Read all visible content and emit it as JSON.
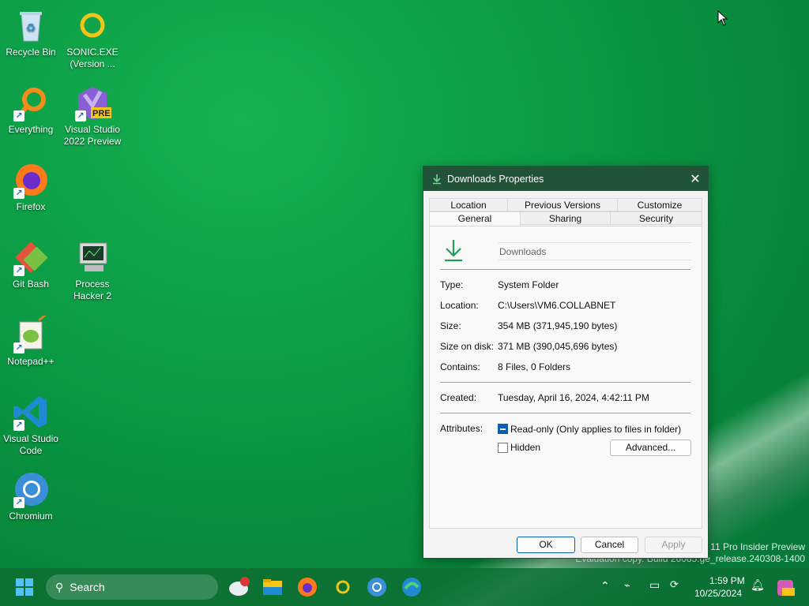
{
  "desktop_icons": [
    {
      "label": "Recycle Bin",
      "icon": "recycle-bin-icon"
    },
    {
      "label": "SONIC.EXE (Version ...",
      "icon": "sonic-icon"
    },
    {
      "label": "Everything",
      "icon": "everything-search-icon"
    },
    {
      "label": "Visual Studio 2022 Preview",
      "icon": "visual-studio-preview-icon",
      "badge": "PRE"
    },
    {
      "label": "Firefox",
      "icon": "firefox-icon"
    },
    {
      "label": "Git Bash",
      "icon": "git-bash-icon"
    },
    {
      "label": "Process Hacker 2",
      "icon": "process-hacker-icon"
    },
    {
      "label": "Notepad++",
      "icon": "notepad-plus-plus-icon"
    },
    {
      "label": "Visual Studio Code",
      "icon": "vscode-icon"
    },
    {
      "label": "Chromium",
      "icon": "chromium-icon"
    }
  ],
  "dialog": {
    "title": "Downloads Properties",
    "tabs_row1": [
      "Location",
      "Previous Versions",
      "Customize"
    ],
    "tabs_row2": [
      "General",
      "Sharing",
      "Security"
    ],
    "active_tab": "General",
    "folder_name": "Downloads",
    "props": [
      {
        "label": "Type:",
        "value": "System Folder"
      },
      {
        "label": "Location:",
        "value": "C:\\Users\\VM6.COLLABNET"
      },
      {
        "label": "Size:",
        "value": "354 MB (371,945,190 bytes)"
      },
      {
        "label": "Size on disk:",
        "value": "371 MB (390,045,696 bytes)"
      },
      {
        "label": "Contains:",
        "value": "8 Files, 0 Folders"
      }
    ],
    "created_label": "Created:",
    "created_value": "Tuesday, April 16, 2024, 4:42:11 PM",
    "attributes_label": "Attributes:",
    "readonly_label": "Read-only (Only applies to files in folder)",
    "hidden_label": "Hidden",
    "advanced_label": "Advanced...",
    "ok_label": "OK",
    "cancel_label": "Cancel",
    "apply_label": "Apply"
  },
  "taskbar": {
    "search_placeholder": "Search",
    "time": "1:59 PM",
    "date": "10/25/2024"
  },
  "watermark": {
    "line1": "s 11 Pro Insider Preview",
    "line2": "Evaluation copy. Build 26085.ge_release.240308-1400"
  },
  "colors": {
    "accent": "#0a5fb4",
    "titlebar": "#205338",
    "desktop": "#0a9a44"
  }
}
